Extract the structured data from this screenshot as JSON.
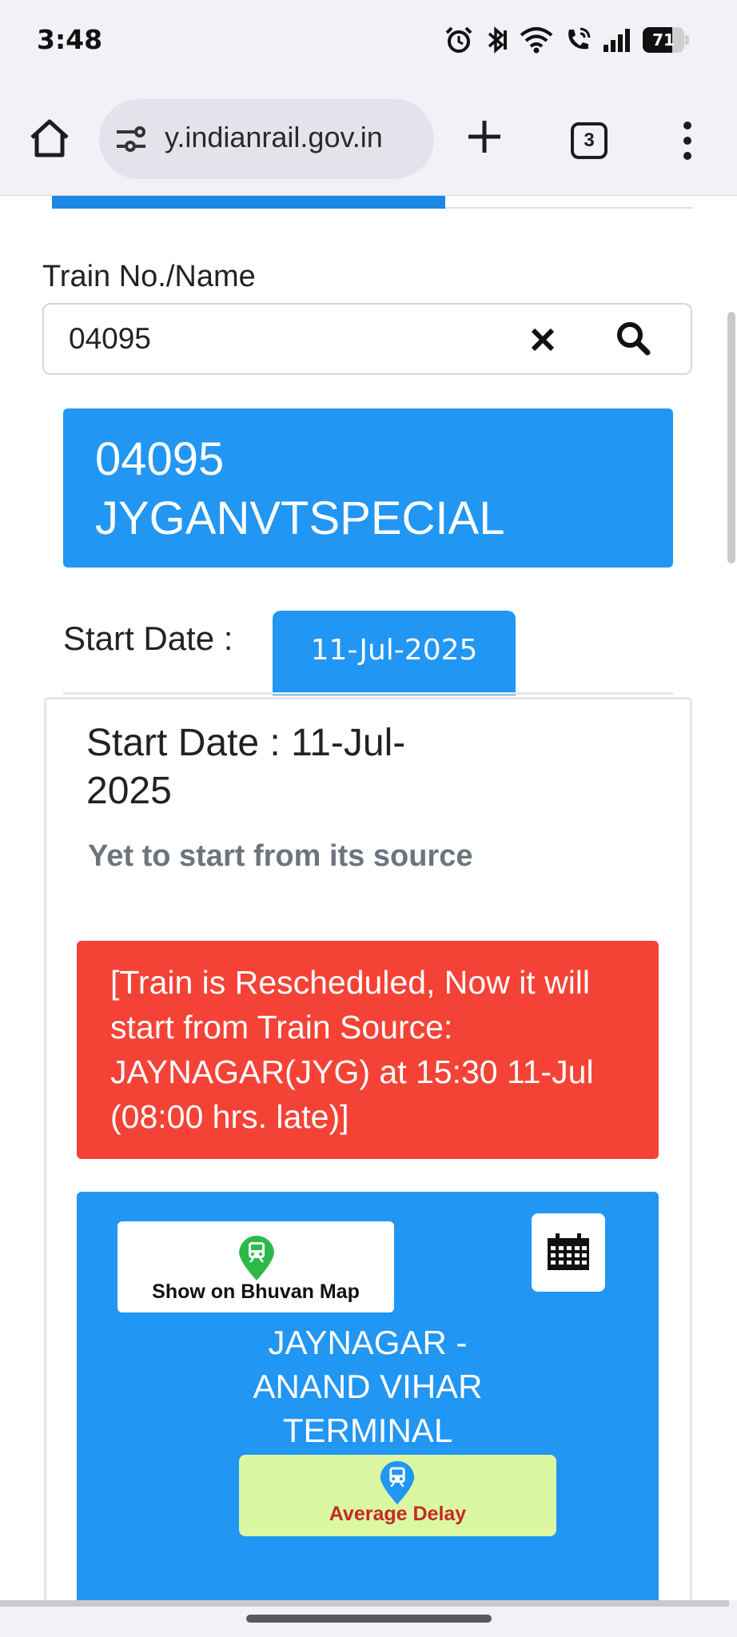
{
  "status_bar": {
    "time": "3:48",
    "battery": "71",
    "battery_level": 0.71,
    "icons": [
      "alarm-icon",
      "bluetooth-icon",
      "wifi-icon",
      "wifi-calling-icon",
      "signal-icon",
      "battery-icon"
    ]
  },
  "browser": {
    "url": "y.indianrail.gov.in",
    "tab_count": "3",
    "icons": [
      "home-icon",
      "site-settings-icon",
      "new-tab-icon",
      "tab-switcher-icon",
      "menu-icon"
    ]
  },
  "search": {
    "label": "Train No./Name",
    "value": "04095"
  },
  "train": {
    "number": "04095",
    "name": "JYGANVTSPECIAL"
  },
  "start_date": {
    "label": "Start Date :",
    "selected": "11-Jul-2025"
  },
  "card": {
    "title": "Start Date : 11-Jul-2025",
    "status": "Yet to start from its source",
    "alert": "[Train is Rescheduled, Now it will start from Train Source: JAYNAGAR(JYG) at 15:30 11-Jul (08:00 hrs. late)]",
    "map_button": "Show on Bhuvan Map",
    "route": "JAYNAGAR - ANAND VIHAR TERMINAL",
    "delay_button": "Average Delay"
  },
  "colors": {
    "primary_blue": "#2196f3",
    "alert_red": "#f44336",
    "delay_green": "#dcf7a1",
    "delay_text": "#c62828",
    "pin_green": "#2db84a"
  }
}
